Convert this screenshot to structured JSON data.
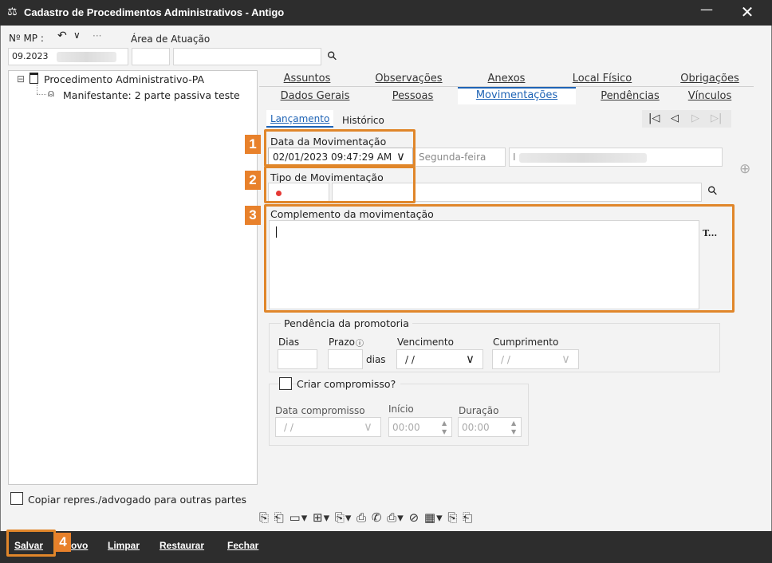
{
  "window": {
    "title": "Cadastro de Procedimentos Administrativos - Antigo",
    "minimize": "—",
    "close": "✕"
  },
  "header": {
    "mp_label": "Nº MP :",
    "mp_value": "09.2023",
    "undo_glyph": "↶",
    "caret_glyph": "∨",
    "ellipsis": "···",
    "area_label": "Área de Atuação",
    "search_glyph": "⚲"
  },
  "tree": {
    "root_label": "Procedimento Administrativo-PA",
    "child_label": "Manifestante: 2 parte passiva teste",
    "collapse_glyph": "⊟"
  },
  "tabs_top": [
    "Assuntos",
    "Observações",
    "Anexos",
    "Local Físico",
    "Obrigações"
  ],
  "tabs_bottom": [
    "Dados Gerais",
    "Pessoas",
    "Movimentações",
    "Pendências",
    "Vínculos"
  ],
  "subtabs": [
    "Lançamento",
    "Histórico"
  ],
  "nav": {
    "first": "|◁",
    "prev": "◁",
    "next": "▷",
    "last": "▷|"
  },
  "form": {
    "data_mov_label": "Data da Movimentação",
    "data_mov_value": "02/01/2023 09:47:29 AM",
    "weekday": "Segunda-feira",
    "tipo_label": "Tipo de Movimentação",
    "complemento_label": "Complemento da movimentação",
    "t_button": "T...",
    "add_glyph": "⊕",
    "pendencia_title": "Pendência da promotoria",
    "dias_label": "Dias",
    "prazo_label": "Prazo",
    "prazo_info": "ⓘ",
    "dias_unit": "dias",
    "vencimento_label": "Vencimento",
    "vencimento_value": "/ /",
    "cumprimento_label": "Cumprimento",
    "cumprimento_value": "/ /",
    "criar_label": "Criar compromisso?",
    "data_comp_label": "Data compromisso",
    "data_comp_value": "/ /",
    "inicio_label": "Início",
    "inicio_value": "00:00",
    "duracao_label": "Duração",
    "duracao_value": "00:00",
    "copiar_label": "Copiar repres./advogado para outras partes"
  },
  "badges": [
    "1",
    "2",
    "3",
    "4"
  ],
  "toolbar_icons": "⎘ ⎗ ▭▾ ⊞▾ ⎘▾ ⎙ ✆ ⎙▾ ⊘ ▦▾ ⎘ ⎗",
  "bottom": {
    "salvar": "Salvar",
    "novo": "ovo",
    "limpar": "Limpar",
    "restaurar": "Restaurar",
    "fechar": "Fechar"
  },
  "colors": {
    "accent": "#e0862a",
    "link": "#1e63b5",
    "bar": "#2d2d2d"
  }
}
